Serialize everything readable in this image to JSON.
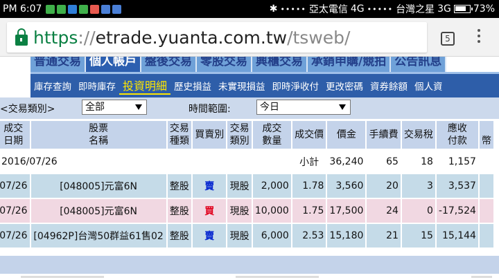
{
  "status_bar": {
    "time": "PM 6:07",
    "carrier1": "亞太電信",
    "network1": "4G",
    "carrier2": "台灣之星",
    "network2": "3G",
    "battery": "73%",
    "signal_dots": "•••••"
  },
  "browser": {
    "url_scheme": "https",
    "url_sep": "://",
    "url_host": "etrade.yuanta.com.tw",
    "url_path": "/tsweb/",
    "tab_count": "5"
  },
  "nav_top": {
    "tabs": [
      "普通交易",
      "個人帳戶",
      "盤後交易",
      "零股交易",
      "興櫃交易",
      "承銷申購/競拍",
      "公告訊息"
    ],
    "active_index": 1
  },
  "nav_sub": {
    "items": [
      "庫存查詢",
      "即時庫存",
      "投資明細",
      "歷史損益",
      "未實現損益",
      "即時淨收付",
      "更改密碼",
      "資券餘額",
      "個人資"
    ]
  },
  "filter": {
    "type_label": "<交易類別>",
    "type_value": "全部",
    "range_label": "時間範圍:",
    "range_value": "今日"
  },
  "table": {
    "headers": [
      [
        "成交",
        "日期"
      ],
      [
        "股票",
        "名稱"
      ],
      [
        "交易",
        "種類"
      ],
      [
        "買賣別",
        ""
      ],
      [
        "交易",
        "類別"
      ],
      [
        "成交",
        "數量"
      ],
      [
        "成交價",
        ""
      ],
      [
        "價金",
        ""
      ],
      [
        "手續費",
        ""
      ],
      [
        "交易稅",
        ""
      ],
      [
        "應收",
        "付款"
      ],
      [
        "",
        "幣"
      ]
    ],
    "summary": {
      "date": "2016/07/26",
      "label": "小計",
      "amount": "36,240",
      "fee": "65",
      "tax": "18",
      "net": "1,157"
    },
    "rows": [
      {
        "date": "07/26",
        "name": "[048005]元富6N",
        "kind": "整股",
        "side": "賣",
        "cls": "現股",
        "qty": "2,000",
        "price": "1.78",
        "amount": "3,560",
        "fee": "20",
        "tax": "3",
        "net": "3,537"
      },
      {
        "date": "07/26",
        "name": "[048005]元富6N",
        "kind": "整股",
        "side": "買",
        "cls": "現股",
        "qty": "10,000",
        "price": "1.75",
        "amount": "17,500",
        "fee": "24",
        "tax": "0",
        "net": "-17,524"
      },
      {
        "date": "07/26",
        "name": "[04962P]台灣50群益61售02",
        "kind": "整股",
        "side": "賣",
        "cls": "現股",
        "qty": "6,000",
        "price": "2.53",
        "amount": "15,180",
        "fee": "21",
        "tax": "15",
        "net": "15,144"
      }
    ]
  },
  "colors": {
    "nav_top_bg": "#6fa1d8",
    "nav_sub_bg": "#2e5ea9",
    "sell": "#0a2ad0",
    "buy": "#e0001c",
    "row_sell": "#c5dbe8",
    "row_buy": "#f1d8e2"
  }
}
